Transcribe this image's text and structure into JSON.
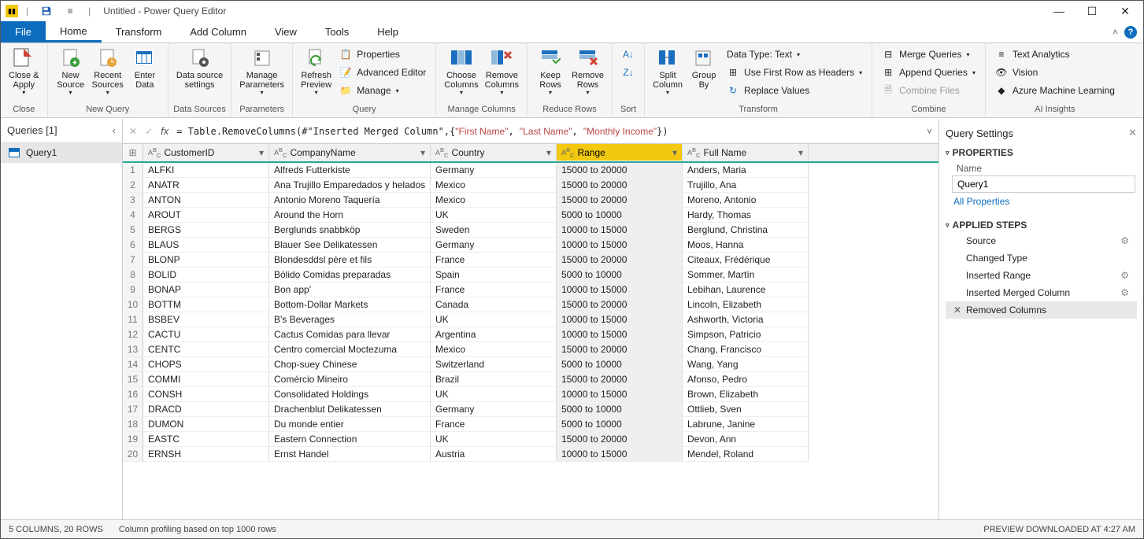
{
  "title": "Untitled - Power Query Editor",
  "tabs": {
    "file": "File",
    "home": "Home",
    "transform": "Transform",
    "addcol": "Add Column",
    "view": "View",
    "tools": "Tools",
    "help": "Help"
  },
  "ribbon": {
    "close_apply": "Close &\nApply",
    "close_group": "Close",
    "new_source": "New\nSource",
    "recent_sources": "Recent\nSources",
    "enter_data": "Enter\nData",
    "newquery_group": "New Query",
    "data_source_settings": "Data source\nsettings",
    "datasources_group": "Data Sources",
    "manage_params": "Manage\nParameters",
    "params_group": "Parameters",
    "refresh_preview": "Refresh\nPreview",
    "properties": "Properties",
    "adv_editor": "Advanced Editor",
    "manage": "Manage",
    "query_group": "Query",
    "choose_cols": "Choose\nColumns",
    "remove_cols": "Remove\nColumns",
    "managecols_group": "Manage Columns",
    "keep_rows": "Keep\nRows",
    "remove_rows": "Remove\nRows",
    "reducerows_group": "Reduce Rows",
    "sortaz": "A→Z",
    "sortza": "Z→A",
    "sort_group": "Sort",
    "split_col": "Split\nColumn",
    "group_by": "Group\nBy",
    "datatype": "Data Type: Text",
    "first_row_headers": "Use First Row as Headers",
    "replace_values": "Replace Values",
    "transform_group": "Transform",
    "merge": "Merge Queries",
    "append": "Append Queries",
    "combine_files": "Combine Files",
    "combine_group": "Combine",
    "text_analytics": "Text Analytics",
    "vision": "Vision",
    "azureml": "Azure Machine Learning",
    "ai_group": "AI Insights"
  },
  "queries": {
    "header": "Queries [1]",
    "item": "Query1"
  },
  "formula": {
    "prefix": "= Table.RemoveColumns(#\"Inserted Merged Column\",{",
    "args": [
      "\"First Name\"",
      "\"Last Name\"",
      "\"Monthly Income\""
    ],
    "suffix": "})"
  },
  "columns": [
    "CustomerID",
    "CompanyName",
    "Country",
    "Range",
    "Full Name"
  ],
  "rows": [
    [
      "ALFKI",
      "Alfreds Futterkiste",
      "Germany",
      "15000 to 20000",
      "Anders, Maria"
    ],
    [
      "ANATR",
      "Ana Trujillo Emparedados y helados",
      "Mexico",
      "15000 to 20000",
      "Trujillo, Ana"
    ],
    [
      "ANTON",
      "Antonio Moreno Taquería",
      "Mexico",
      "15000 to 20000",
      "Moreno, Antonio"
    ],
    [
      "AROUT",
      "Around the Horn",
      "UK",
      "5000 to 10000",
      "Hardy, Thomas"
    ],
    [
      "BERGS",
      "Berglunds snabbköp",
      "Sweden",
      "10000 to 15000",
      "Berglund, Christina"
    ],
    [
      "BLAUS",
      "Blauer See Delikatessen",
      "Germany",
      "10000 to 15000",
      "Moos, Hanna"
    ],
    [
      "BLONP",
      "Blondesddsl père et fils",
      "France",
      "15000 to 20000",
      "Citeaux, Frédérique"
    ],
    [
      "BOLID",
      "Bólido Comidas preparadas",
      "Spain",
      "5000 to 10000",
      "Sommer, Martín"
    ],
    [
      "BONAP",
      "Bon app'",
      "France",
      "10000 to 15000",
      "Lebihan, Laurence"
    ],
    [
      "BOTTM",
      "Bottom-Dollar Markets",
      "Canada",
      "15000 to 20000",
      "Lincoln, Elizabeth"
    ],
    [
      "BSBEV",
      "B's Beverages",
      "UK",
      "10000 to 15000",
      "Ashworth, Victoria"
    ],
    [
      "CACTU",
      "Cactus Comidas para llevar",
      "Argentina",
      "10000 to 15000",
      "Simpson, Patricio"
    ],
    [
      "CENTC",
      "Centro comercial Moctezuma",
      "Mexico",
      "15000 to 20000",
      "Chang, Francisco"
    ],
    [
      "CHOPS",
      "Chop-suey Chinese",
      "Switzerland",
      "5000 to 10000",
      "Wang, Yang"
    ],
    [
      "COMMI",
      "Comércio Mineiro",
      "Brazil",
      "15000 to 20000",
      "Afonso, Pedro"
    ],
    [
      "CONSH",
      "Consolidated Holdings",
      "UK",
      "10000 to 15000",
      "Brown, Elizabeth"
    ],
    [
      "DRACD",
      "Drachenblut Delikatessen",
      "Germany",
      "5000 to 10000",
      "Ottlieb, Sven"
    ],
    [
      "DUMON",
      "Du monde entier",
      "France",
      "5000 to 10000",
      "Labrune, Janine"
    ],
    [
      "EASTC",
      "Eastern Connection",
      "UK",
      "15000 to 20000",
      "Devon, Ann"
    ],
    [
      "ERNSH",
      "Ernst Handel",
      "Austria",
      "10000 to 15000",
      "Mendel, Roland"
    ]
  ],
  "settings": {
    "header": "Query Settings",
    "properties": "PROPERTIES",
    "name_label": "Name",
    "name_value": "Query1",
    "all_props": "All Properties",
    "applied": "APPLIED STEPS",
    "steps": [
      "Source",
      "Changed Type",
      "Inserted Range",
      "Inserted Merged Column",
      "Removed Columns"
    ]
  },
  "status": {
    "left": "5 COLUMNS, 20 ROWS",
    "mid": "Column profiling based on top 1000 rows",
    "right": "PREVIEW DOWNLOADED AT 4:27 AM"
  }
}
